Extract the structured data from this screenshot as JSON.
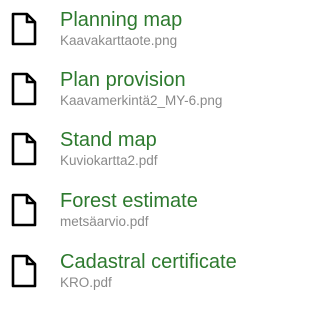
{
  "accent_color": "#2d7a2e",
  "filename_color": "#8a8a8a",
  "documents": [
    {
      "title": "Planning map",
      "filename": "Kaavakarttaote.png",
      "icon": "document-icon"
    },
    {
      "title": "Plan provision",
      "filename": "Kaavamerkintä2_MY-6.png",
      "icon": "document-icon"
    },
    {
      "title": "Stand map",
      "filename": "Kuviokartta2.pdf",
      "icon": "document-icon"
    },
    {
      "title": "Forest estimate",
      "filename": "metsäarvio.pdf",
      "icon": "document-icon"
    },
    {
      "title": "Cadastral certificate",
      "filename": "KRO.pdf",
      "icon": "document-icon"
    }
  ]
}
